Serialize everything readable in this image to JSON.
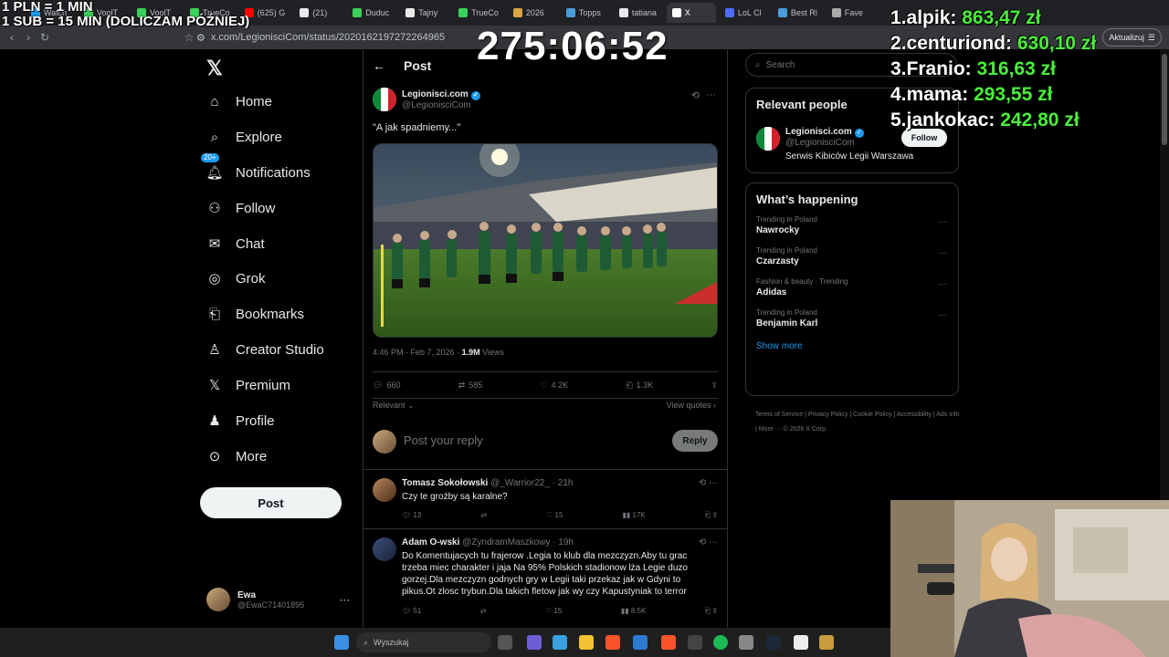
{
  "browser": {
    "tabs": [
      {
        "label": "Watch",
        "color": "#1d9bf0"
      },
      {
        "label": "VoolT",
        "color": "#3ad15a"
      },
      {
        "label": "VoolT",
        "color": "#3ad15a"
      },
      {
        "label": "TrueCo",
        "color": "#3ad15a"
      },
      {
        "label": "(625) G",
        "color": "#ff0000"
      },
      {
        "label": "(21)",
        "color": "#e7e9ea"
      },
      {
        "label": "Duduc",
        "color": "#3ad15a"
      },
      {
        "label": "Tajny",
        "color": "#e7e9ea"
      },
      {
        "label": "TrueCo",
        "color": "#3ad15a"
      },
      {
        "label": "2026",
        "color": "#d9a441"
      },
      {
        "label": "Topps",
        "color": "#4a9ed8"
      },
      {
        "label": "tatiana",
        "color": "#e7e9ea"
      },
      {
        "label": "X",
        "color": "#ffffff",
        "active": true
      },
      {
        "label": "LoL Cl",
        "color": "#4e6cff"
      },
      {
        "label": "Best Ri",
        "color": "#4a9ed8"
      },
      {
        "label": "Fave",
        "color": "#aaaaaa"
      }
    ],
    "url": "x.com/LegionisciCom/status/2020162197272264965",
    "update_label": "Aktualizuj"
  },
  "stream": {
    "rules": [
      "1 PLN = 1 MIN",
      "1 SUB = 15 MIN (DOLICZAM PÓŹNIEJ)"
    ],
    "timer": "275:06:52",
    "donors": [
      {
        "rank": "1.",
        "name": "alpik:",
        "amount": "863,47 zł"
      },
      {
        "rank": "2.",
        "name": "centuriond:",
        "amount": "630,10 zł"
      },
      {
        "rank": "3.",
        "name": "Franio:",
        "amount": "316,63 zł"
      },
      {
        "rank": "4.",
        "name": "mama:",
        "amount": "293,55 zł"
      },
      {
        "rank": "5.",
        "name": "jankokac:",
        "amount": "242,80 zł"
      }
    ]
  },
  "nav": {
    "items": [
      "Home",
      "Explore",
      "Notifications",
      "Follow",
      "Chat",
      "Grok",
      "Bookmarks",
      "Creator Studio",
      "Premium",
      "Profile",
      "More"
    ],
    "notif_badge": "20+",
    "post_button": "Post",
    "account": {
      "name": "Ewa",
      "handle": "@EwaC71401895"
    }
  },
  "main": {
    "header": "Post",
    "author_name": "Legionisci.com",
    "author_handle": "@LegionisciCom",
    "text": "\"A jak spadniemy...\"",
    "meta_time": "4:46 PM · Feb 7, 2026 · ",
    "meta_views_count": "1.9M",
    "meta_views_label": " Views",
    "stats": {
      "replies": "660",
      "reposts": "585",
      "likes": "4.2K",
      "bookmarks": "1.3K"
    },
    "sort_label": "Relevant",
    "view_quotes": "View quotes",
    "reply_placeholder": "Post your reply",
    "reply_button": "Reply",
    "comments": [
      {
        "name": "Tomasz Sokołowski",
        "handle": "@_Warrior22_ · 21h",
        "text": "Czy te groźby są karalne?",
        "replies": "13",
        "reposts": "",
        "likes": "15",
        "views": "17K"
      },
      {
        "name": "Adam O-wski",
        "handle": "@ZyndramMaszkowy · 19h",
        "text": "Do Komentujacych tu frajerow .Legia to klub dla mezczyzn.Aby tu grac trzeba miec charakter i jaja Na 95% Polskich stadionow lża Legie duzo gorzej.Dla mezczyzn godnych gry w Legii taki przekaz jak w Gdyni to pikus.Ot zlosc trybun.Dla takich fletow jak wy czy Kapustyniak to terror",
        "replies": "51",
        "reposts": "",
        "likes": "15",
        "views": "8.5K"
      }
    ]
  },
  "right": {
    "search_placeholder": "Search",
    "relevant_title": "Relevant people",
    "person_name": "Legionisci.com",
    "person_handle": "@LegionisciCom",
    "person_bio": "Serwis Kibiców Legii Warszawa",
    "follow_label": "Follow",
    "happening_title": "What’s happening",
    "trends": [
      {
        "label": "Trending in Poland",
        "name": "Nawrocky"
      },
      {
        "label": "Trending in Poland",
        "name": "Czarzasty"
      },
      {
        "label": "Fashion & beauty · Trending",
        "name": "Adidas"
      },
      {
        "label": "Trending in Poland",
        "name": "Benjamin Karl"
      }
    ],
    "show_more": "Show more",
    "footer": "Terms of Service  |  Privacy Policy  |  Cookie Policy  |  Accessibility  |  Ads info  |  More ···  © 2026 X Corp."
  },
  "taskbar": {
    "search_placeholder": "Wyszukaj"
  }
}
